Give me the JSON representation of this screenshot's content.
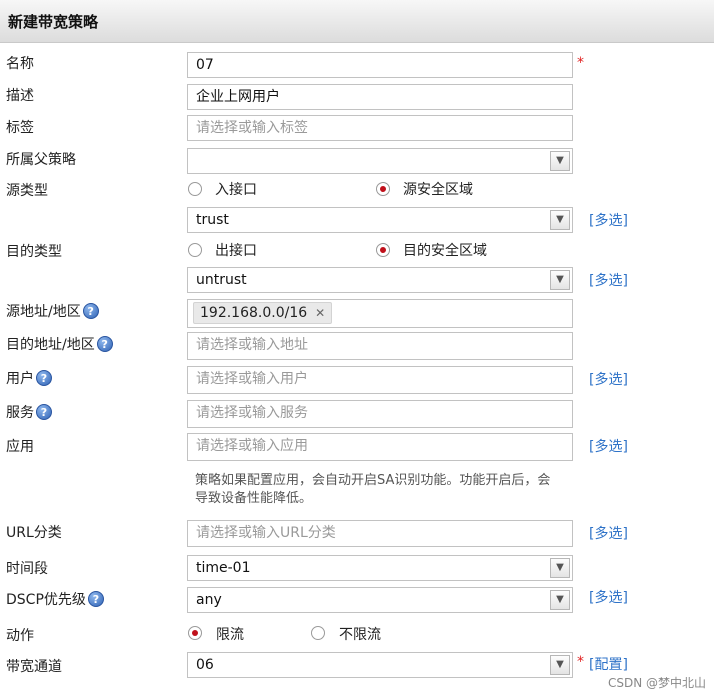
{
  "header": {
    "title": "新建带宽策略"
  },
  "form": {
    "name": {
      "label": "名称",
      "value": "07"
    },
    "description": {
      "label": "描述",
      "value": "企业上网用户"
    },
    "tags": {
      "label": "标签",
      "placeholder": "请选择或输入标签"
    },
    "parent_policy": {
      "label": "所属父策略",
      "value": ""
    },
    "source_type": {
      "label": "源类型",
      "option1": "入接口",
      "option2": "源安全区域",
      "selected": "源安全区域",
      "zone_value": "trust",
      "multi_label": "[多选]"
    },
    "dest_type": {
      "label": "目的类型",
      "option1": "出接口",
      "option2": "目的安全区域",
      "selected": "目的安全区域",
      "zone_value": "untrust",
      "multi_label": "[多选]"
    },
    "source_address": {
      "label": "源地址/地区",
      "help": "?",
      "tag_value": "192.168.0.0/16",
      "tag_remove": "✕"
    },
    "dest_address": {
      "label": "目的地址/地区",
      "help": "?",
      "placeholder": "请选择或输入地址"
    },
    "user": {
      "label": "用户",
      "help": "?",
      "placeholder": "请选择或输入用户",
      "multi_label": "[多选]"
    },
    "service": {
      "label": "服务",
      "help": "?",
      "placeholder": "请选择或输入服务"
    },
    "application": {
      "label": "应用",
      "placeholder": "请选择或输入应用",
      "multi_label": "[多选]",
      "note": "策略如果配置应用，会自动开启SA识别功能。功能开启后，会导致设备性能降低。"
    },
    "url_category": {
      "label": "URL分类",
      "placeholder": "请选择或输入URL分类",
      "multi_label": "[多选]"
    },
    "time_range": {
      "label": "时间段",
      "value": "time-01"
    },
    "dscp": {
      "label": "DSCP优先级",
      "help": "?",
      "value": "any",
      "multi_label": "[多选]"
    },
    "action": {
      "label": "动作",
      "option1": "限流",
      "option2": "不限流",
      "selected": "限流"
    },
    "bandwidth_channel": {
      "label": "带宽通道",
      "value": "06",
      "config_label": "[配置]"
    },
    "required_mark": "*"
  },
  "watermark": "CSDN @梦中北山"
}
